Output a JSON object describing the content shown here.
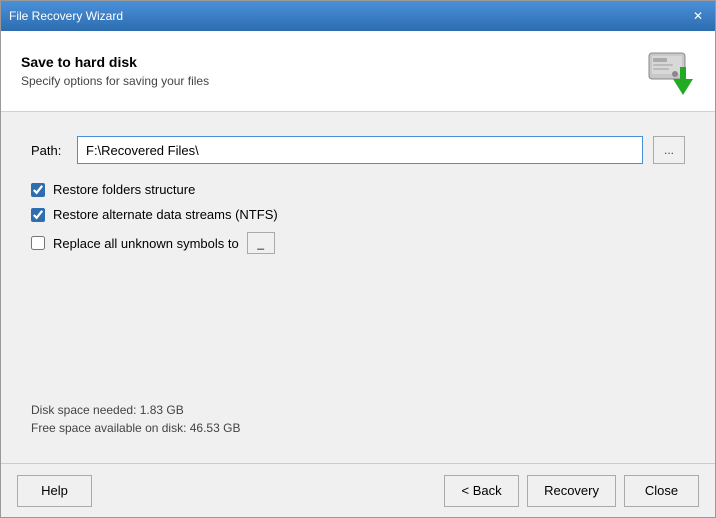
{
  "window": {
    "title": "File Recovery Wizard",
    "close_btn": "✕"
  },
  "header": {
    "title": "Save to hard disk",
    "subtitle": "Specify options for saving your files"
  },
  "path": {
    "label": "Path:",
    "value": "F:\\Recovered Files\\"
  },
  "browse_btn": "...",
  "checkboxes": [
    {
      "id": "cb1",
      "label": "Restore folders structure",
      "checked": true
    },
    {
      "id": "cb2",
      "label": "Restore alternate data streams (NTFS)",
      "checked": true
    },
    {
      "id": "cb3",
      "label": "Replace all unknown symbols to",
      "checked": false
    }
  ],
  "replace_symbol": "_",
  "disk_info": {
    "space_needed": "Disk space needed:  1.83 GB",
    "free_space": "Free space available on disk:  46.53 GB"
  },
  "buttons": {
    "help": "Help",
    "back": "< Back",
    "recovery": "Recovery",
    "close": "Close"
  }
}
